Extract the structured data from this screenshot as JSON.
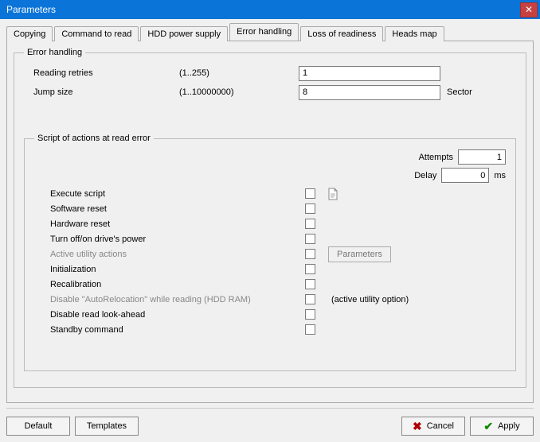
{
  "window": {
    "title": "Parameters"
  },
  "tabs": {
    "t0": "Copying",
    "t1": "Command to read",
    "t2": "HDD power supply",
    "t3": "Error handling",
    "t4": "Loss of readiness",
    "t5": "Heads map"
  },
  "group1": {
    "legend": "Error handling",
    "reading_retries_label": "Reading retries",
    "reading_retries_range": "(1..255)",
    "reading_retries_value": "1",
    "jump_size_label": "Jump size",
    "jump_size_range": "(1..10000000)",
    "jump_size_value": "8",
    "jump_size_unit": "Sector"
  },
  "group2": {
    "legend": "Script of actions at read error",
    "attempts_label": "Attempts",
    "attempts_value": "1",
    "delay_label": "Delay",
    "delay_value": "0",
    "delay_unit": "ms",
    "rows": {
      "r0": "Execute script",
      "r1": "Software reset",
      "r2": "Hardware reset",
      "r3": "Turn off/on drive's power",
      "r4": "Active utility actions",
      "r5": "Initialization",
      "r6": "Recalibration",
      "r7": "Disable \"AutoRelocation\" while reading (HDD RAM)",
      "r8": "Disable read look-ahead",
      "r9": "Standby command"
    },
    "parameters_btn": "Parameters",
    "active_note": "(active utility option)"
  },
  "footer": {
    "default": "Default",
    "templates": "Templates",
    "cancel": "Cancel",
    "apply": "Apply"
  }
}
